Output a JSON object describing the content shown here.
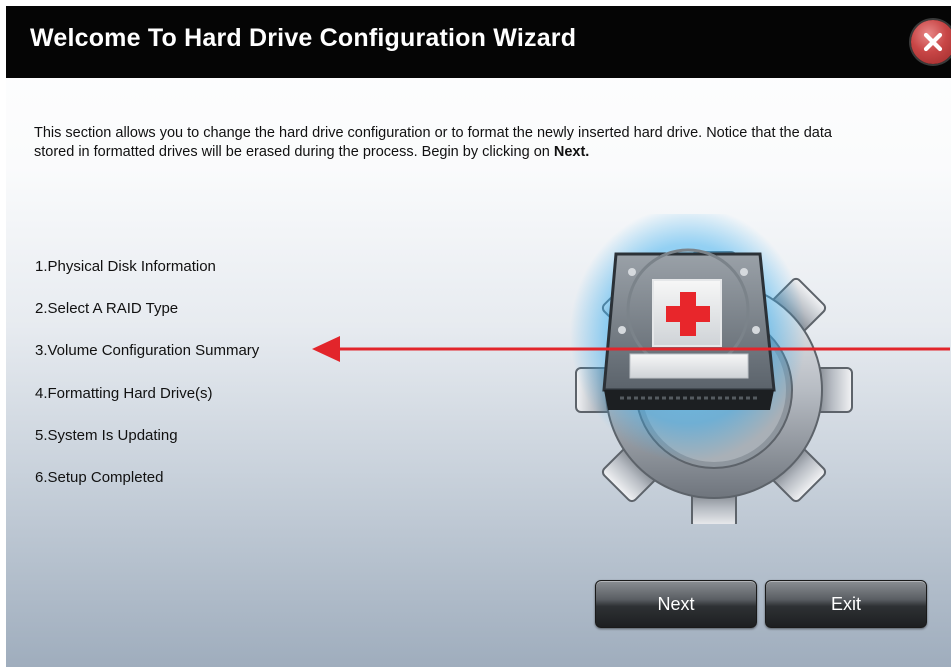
{
  "window": {
    "title": "Welcome To Hard Drive Configuration Wizard",
    "close_icon": "close-icon"
  },
  "intro": {
    "text": "This section allows you to change the hard drive configuration or to format the newly inserted hard drive. Notice that the data stored in formatted drives will be erased during the process. Begin by clicking on ",
    "bold": "Next."
  },
  "steps": [
    "1.Physical Disk Information",
    "2.Select A RAID Type",
    "3.Volume Configuration Summary",
    "4.Formatting Hard Drive(s)",
    "5.System Is Updating",
    "6.Setup Completed"
  ],
  "illustration": {
    "icon": "hard-drive-gear-icon",
    "cross_color": "#e8262b"
  },
  "buttons": {
    "next": "Next",
    "exit": "Exit"
  },
  "annotation": {
    "arrow_color": "#e2252b",
    "points_to": "3.Volume Configuration Summary"
  }
}
